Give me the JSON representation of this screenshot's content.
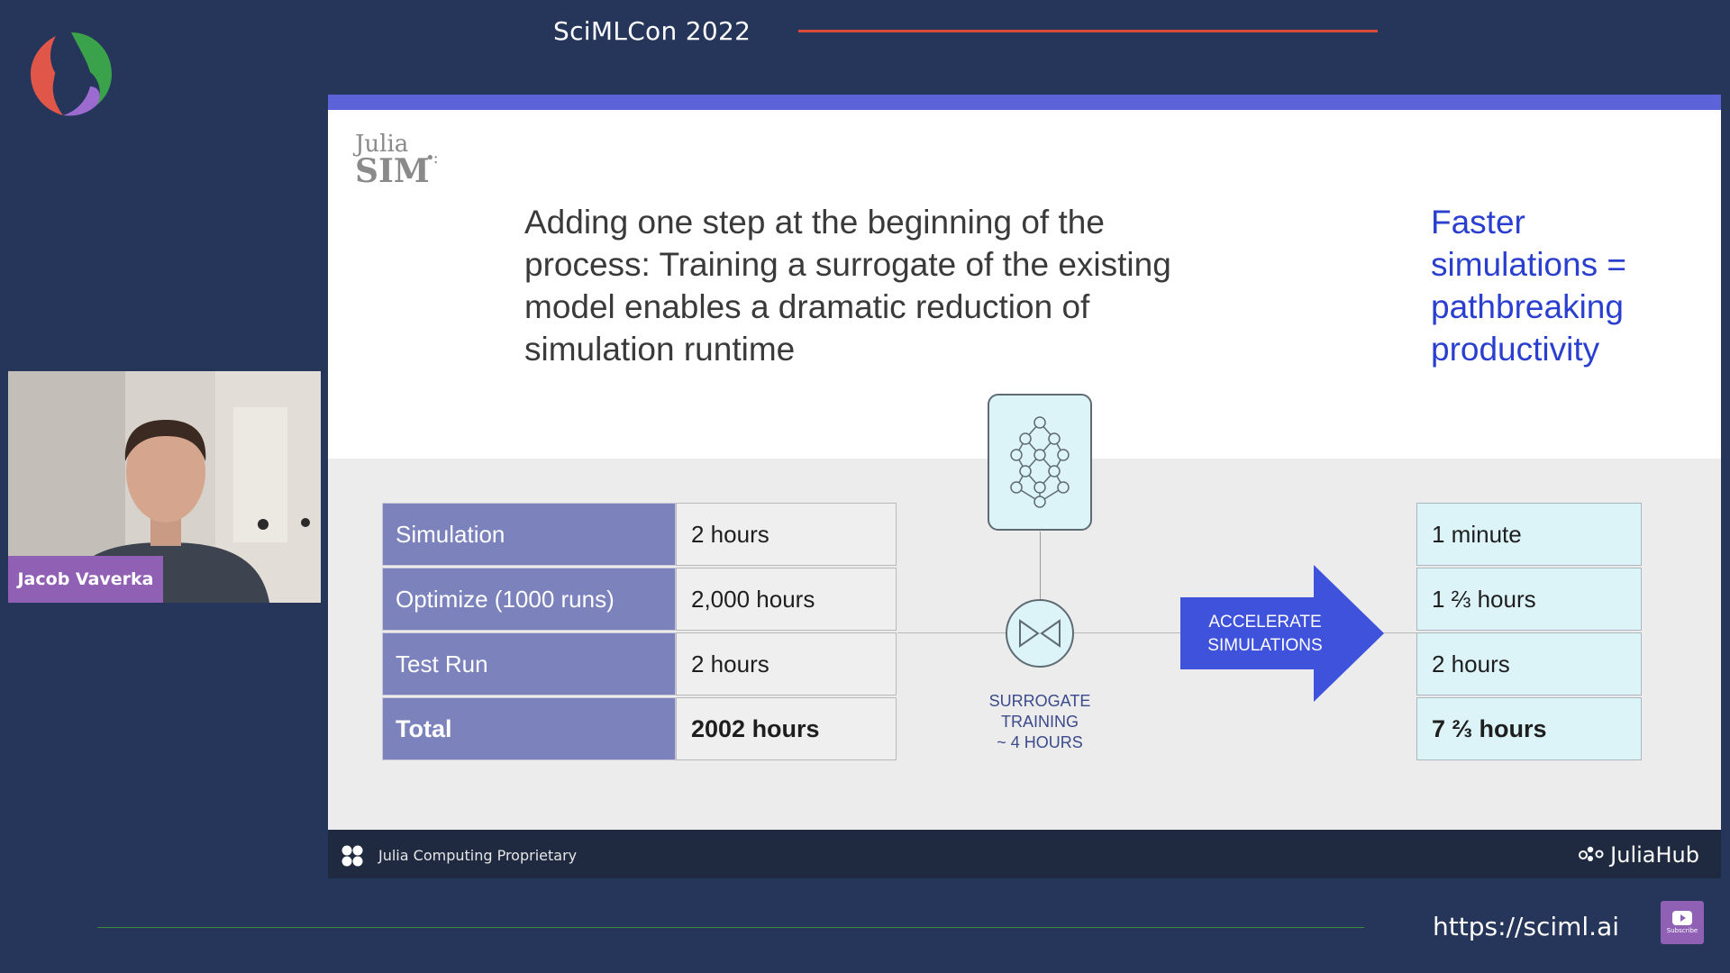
{
  "header": {
    "conference_title": "SciMLCon 2022"
  },
  "webcam": {
    "speaker_name": "Jacob Vaverka"
  },
  "slide": {
    "brand_logo": {
      "line1": "Julia",
      "line2": "SIM"
    },
    "headline": "Adding one step at the beginning of the process: Training a surrogate of the existing model enables a dramatic reduction of simulation runtime",
    "tagline": "Faster simulations = pathbreaking productivity",
    "before_table": [
      {
        "label": "Simulation",
        "value": "2 hours"
      },
      {
        "label": "Optimize (1000 runs)",
        "value": "2,000 hours"
      },
      {
        "label": "Test Run",
        "value": "2 hours"
      },
      {
        "label": "Total",
        "value": "2002 hours"
      }
    ],
    "surrogate_label": {
      "line1": "SURROGATE",
      "line2": "TRAINING",
      "line3": "~ 4 HOURS"
    },
    "arrow_label": {
      "line1": "ACCELERATE",
      "line2": "SIMULATIONS"
    },
    "after_table": [
      {
        "value": "1 minute"
      },
      {
        "value": "1 ⅔ hours"
      },
      {
        "value": "2 hours"
      },
      {
        "value": "7 ⅔ hours"
      }
    ],
    "footer_left": "Julia Computing Proprietary",
    "footer_right": "JuliaHub"
  },
  "bottom": {
    "url": "https://sciml.ai",
    "subscribe_label": "Subscribe"
  },
  "colors": {
    "background": "#26365a",
    "accent_red": "#d94a3a",
    "slide_top_bar": "#5c63d8",
    "table_label_fill": "#7b82bc",
    "result_fill": "#dcf3f8",
    "arrow_fill": "#3f52db",
    "tagline_blue": "#2a3fcf",
    "speaker_badge": "#8f60b4"
  },
  "icons": {
    "conference_logo": "sciml-logo-icon",
    "neural_network": "neural-network-icon",
    "bowtie": "bowtie-icon",
    "footer_mark": "julia-dots-icon",
    "juliahub_mark": "juliahub-icon",
    "subscribe": "youtube-subscribe-icon"
  }
}
